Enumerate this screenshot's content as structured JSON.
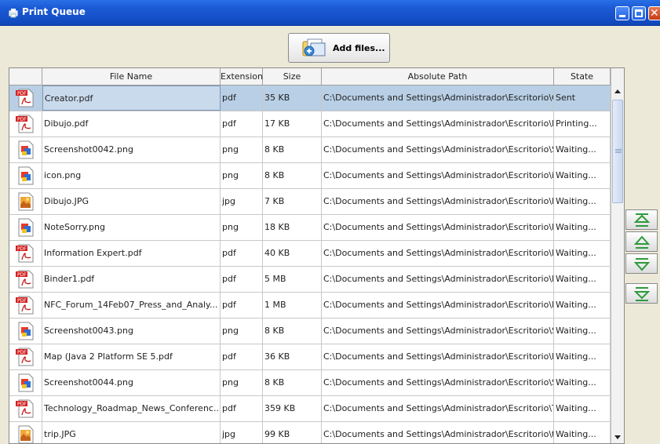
{
  "window": {
    "title": "Print Queue"
  },
  "toolbar": {
    "add_files_label": "Add files..."
  },
  "table": {
    "columns": [
      "File Name",
      "Extension",
      "Size",
      "Absolute Path",
      "State"
    ],
    "rows": [
      {
        "icon": "pdf-icon",
        "name": "Creator.pdf",
        "ext": "pdf",
        "size": "35 KB",
        "path": "C:\\Documents and Settings\\Administrador\\Escritorio\\Cr...",
        "state": "Sent",
        "selected": true
      },
      {
        "icon": "pdf-icon",
        "name": "Dibujo.pdf",
        "ext": "pdf",
        "size": "17 KB",
        "path": "C:\\Documents and Settings\\Administrador\\Escritorio\\Di...",
        "state": "Printing..."
      },
      {
        "icon": "png-icon",
        "name": "Screenshot0042.png",
        "ext": "png",
        "size": "8 KB",
        "path": "C:\\Documents and Settings\\Administrador\\Escritorio\\Sc...",
        "state": "Waiting..."
      },
      {
        "icon": "png-icon",
        "name": "icon.png",
        "ext": "png",
        "size": "8 KB",
        "path": "C:\\Documents and Settings\\Administrador\\Escritorio\\ic...",
        "state": "Waiting..."
      },
      {
        "icon": "jpg-icon",
        "name": "Dibujo.JPG",
        "ext": "jpg",
        "size": "7 KB",
        "path": "C:\\Documents and Settings\\Administrador\\Escritorio\\Di...",
        "state": "Waiting..."
      },
      {
        "icon": "png-icon",
        "name": "NoteSorry.png",
        "ext": "png",
        "size": "18 KB",
        "path": "C:\\Documents and Settings\\Administrador\\Escritorio\\N...",
        "state": "Waiting..."
      },
      {
        "icon": "pdf-icon",
        "name": "Information Expert.pdf",
        "ext": "pdf",
        "size": "40 KB",
        "path": "C:\\Documents and Settings\\Administrador\\Escritorio\\Inf...",
        "state": "Waiting..."
      },
      {
        "icon": "pdf-icon",
        "name": "Binder1.pdf",
        "ext": "pdf",
        "size": "5 MB",
        "path": "C:\\Documents and Settings\\Administrador\\Escritorio\\Bi...",
        "state": "Waiting..."
      },
      {
        "icon": "pdf-icon",
        "name": "NFC_Forum_14Feb07_Press_and_Analy...",
        "ext": "pdf",
        "size": "1 MB",
        "path": "C:\\Documents and Settings\\Administrador\\Escritorio\\N...",
        "state": "Waiting..."
      },
      {
        "icon": "png-icon",
        "name": "Screenshot0043.png",
        "ext": "png",
        "size": "8 KB",
        "path": "C:\\Documents and Settings\\Administrador\\Escritorio\\Sc...",
        "state": "Waiting..."
      },
      {
        "icon": "pdf-icon",
        "name": "Map (Java 2 Platform SE 5.pdf",
        "ext": "pdf",
        "size": "36 KB",
        "path": "C:\\Documents and Settings\\Administrador\\Escritorio\\M...",
        "state": "Waiting..."
      },
      {
        "icon": "png-icon",
        "name": "Screenshot0044.png",
        "ext": "png",
        "size": "8 KB",
        "path": "C:\\Documents and Settings\\Administrador\\Escritorio\\Sc...",
        "state": "Waiting..."
      },
      {
        "icon": "pdf-icon",
        "name": "Technology_Roadmap_News_Conferenc...",
        "ext": "pdf",
        "size": "359 KB",
        "path": "C:\\Documents and Settings\\Administrador\\Escritorio\\Te...",
        "state": "Waiting..."
      },
      {
        "icon": "jpg-icon",
        "name": "trip.JPG",
        "ext": "jpg",
        "size": "99 KB",
        "path": "C:\\Documents and Settings\\Administrador\\Escritorio\\tri...",
        "state": "Waiting..."
      }
    ]
  },
  "side_buttons": [
    "move-to-top-icon",
    "move-up-icon",
    "move-down-icon",
    "move-to-bottom-icon"
  ],
  "colors": {
    "titlebar": "#1550c8",
    "selection": "#b8cfe5",
    "move_arrows": "#2e9a3c"
  }
}
